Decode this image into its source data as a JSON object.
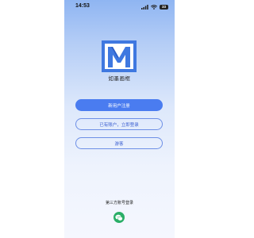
{
  "status_bar": {
    "time": "14:53",
    "battery": "33",
    "signal_icon": "signal-icon",
    "wifi_icon": "wifi-icon"
  },
  "app": {
    "name": "如墨画框",
    "logo_icon": "app-logo-icon"
  },
  "buttons": {
    "register": "新用户注册",
    "login": "已有账户，立即登录",
    "guest": "游客"
  },
  "third_party": {
    "label": "第三方账号登录",
    "wechat_icon": "wechat-icon"
  },
  "colors": {
    "primary": "#4a7cf0",
    "logo_blue": "#3f78e0",
    "wechat_green": "#2aae67"
  }
}
